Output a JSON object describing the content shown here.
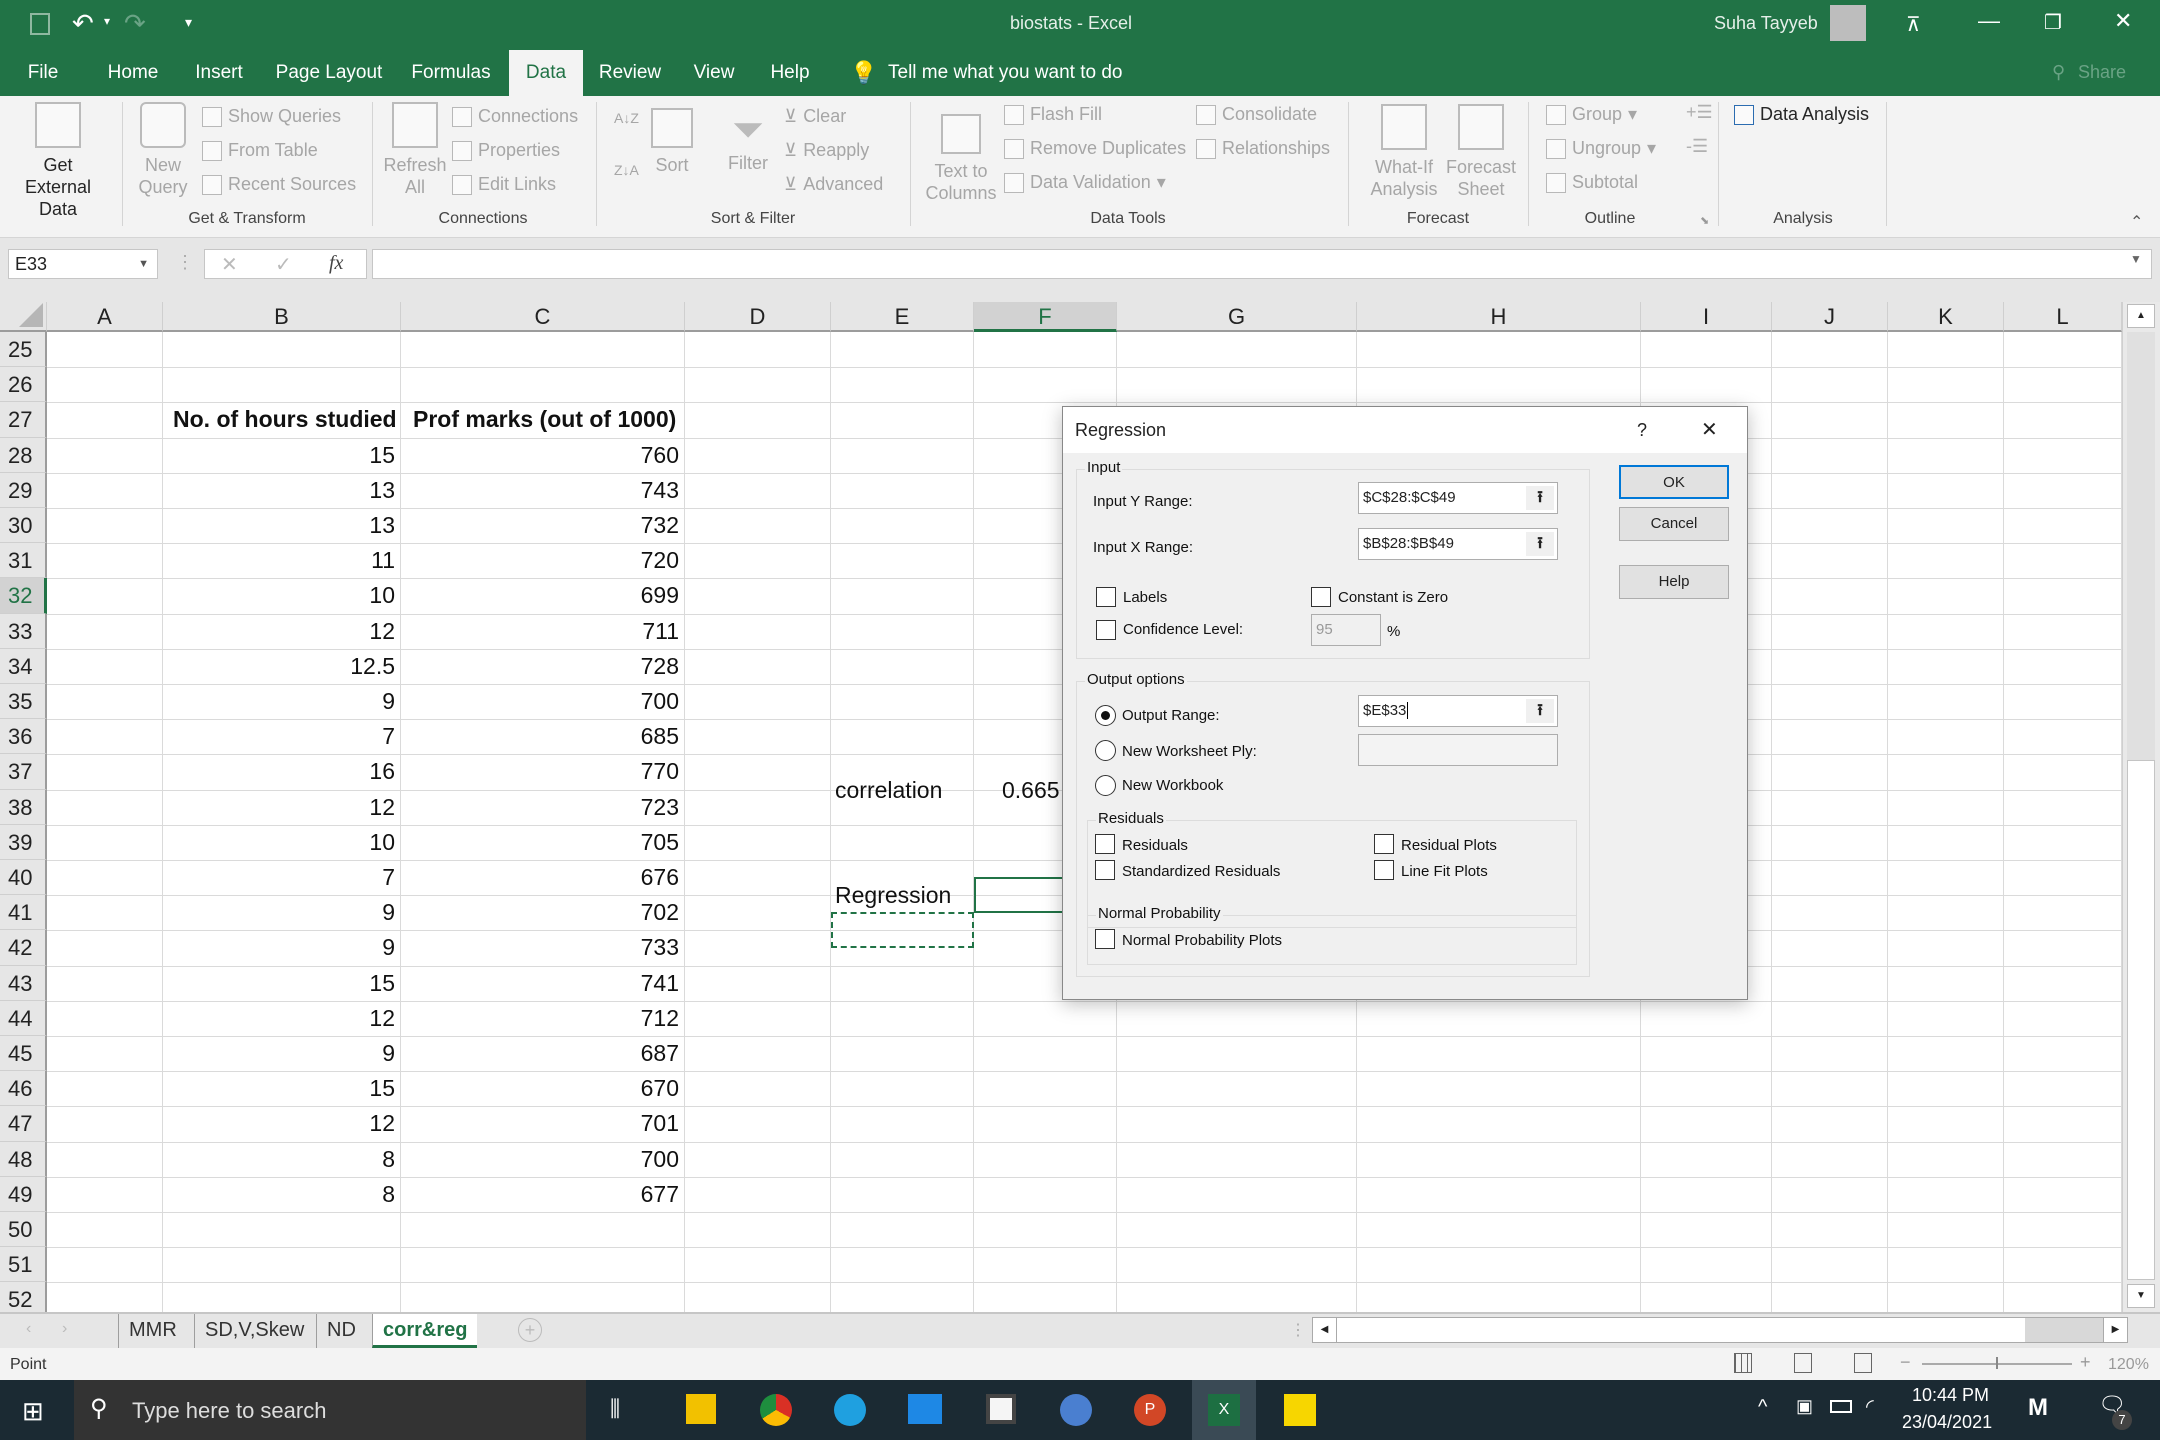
{
  "window": {
    "title": "biostats - Excel",
    "user": "Suha Tayyeb",
    "share_label": "Share"
  },
  "ribbon_tabs": [
    "File",
    "Home",
    "Insert",
    "Page Layout",
    "Formulas",
    "Data",
    "Review",
    "View",
    "Help"
  ],
  "active_tab": "Data",
  "tell_me": "Tell me what you want to do",
  "ribbon": {
    "get_external_data": "Get External Data",
    "get_transform": {
      "label": "Get & Transform",
      "new_query": "New Query",
      "show_queries": "Show Queries",
      "from_table": "From Table",
      "recent_sources": "Recent Sources"
    },
    "connections": {
      "label": "Connections",
      "refresh_all": "Refresh All",
      "connections": "Connections",
      "properties": "Properties",
      "edit_links": "Edit Links"
    },
    "sort_filter": {
      "label": "Sort & Filter",
      "sort": "Sort",
      "filter": "Filter",
      "clear": "Clear",
      "reapply": "Reapply",
      "advanced": "Advanced",
      "sort_az": "A↓Z",
      "sort_za": "Z↓A"
    },
    "data_tools": {
      "label": "Data Tools",
      "text_to_columns": "Text to Columns",
      "flash_fill": "Flash Fill",
      "remove_duplicates": "Remove Duplicates",
      "data_validation": "Data Validation",
      "consolidate": "Consolidate",
      "relationships": "Relationships"
    },
    "forecast": {
      "label": "Forecast",
      "what_if": "What-If Analysis",
      "forecast_sheet": "Forecast Sheet"
    },
    "outline": {
      "label": "Outline",
      "group": "Group",
      "ungroup": "Ungroup",
      "subtotal": "Subtotal"
    },
    "analysis": {
      "label": "Analysis",
      "data_analysis": "Data Analysis"
    }
  },
  "formula_bar": {
    "name_box": "E33",
    "formula": "",
    "fx": "fx"
  },
  "columns": [
    "A",
    "B",
    "C",
    "D",
    "E",
    "F",
    "G",
    "H",
    "I",
    "J",
    "K",
    "L"
  ],
  "selected_column": "F",
  "rows": [
    "25",
    "26",
    "27",
    "28",
    "29",
    "30",
    "31",
    "32",
    "33",
    "34",
    "35",
    "36",
    "37",
    "38",
    "39",
    "40",
    "41",
    "42",
    "43",
    "44",
    "45",
    "46",
    "47",
    "48",
    "49",
    "50",
    "51",
    "52"
  ],
  "selected_row": "32",
  "table": {
    "header_b": "No. of hours studied",
    "header_c": "Prof marks (out of 1000)",
    "hours": [
      "15",
      "13",
      "13",
      "11",
      "10",
      "12",
      "12.5",
      "9",
      "7",
      "16",
      "12",
      "10",
      "7",
      "9",
      "9",
      "15",
      "12",
      "9",
      "15",
      "12",
      "8",
      "8"
    ],
    "marks": [
      "760",
      "743",
      "732",
      "720",
      "699",
      "711",
      "728",
      "700",
      "685",
      "770",
      "723",
      "705",
      "676",
      "702",
      "733",
      "741",
      "712",
      "687",
      "670",
      "701",
      "700",
      "677"
    ]
  },
  "cells": {
    "correlation_label": "correlation",
    "correlation_value": "0.665",
    "regression_label": "Regression"
  },
  "sheet_tabs": [
    "MMR",
    "SD,V,Skew",
    "ND",
    "corr&reg"
  ],
  "active_sheet": "corr&reg",
  "status": {
    "mode": "Point",
    "zoom": "120%"
  },
  "dialog": {
    "title": "Regression",
    "help_glyph": "?",
    "input_group": "Input",
    "input_y_label": "Input Y Range:",
    "input_y_value": "$C$28:$C$49",
    "input_x_label": "Input X Range:",
    "input_x_value": "$B$28:$B$49",
    "labels": "Labels",
    "constant_zero": "Constant is Zero",
    "confidence": "Confidence Level:",
    "confidence_value": "95",
    "percent": "%",
    "output_group": "Output options",
    "output_range": "Output Range:",
    "output_range_value": "$E$33",
    "new_ply": "New Worksheet Ply:",
    "new_ply_value": "",
    "new_workbook": "New Workbook",
    "residuals_group": "Residuals",
    "residuals": "Residuals",
    "std_residuals": "Standardized Residuals",
    "residual_plots": "Residual Plots",
    "line_fit": "Line Fit Plots",
    "normal_group": "Normal Probability",
    "normal_plots": "Normal Probability Plots",
    "ok": "OK",
    "cancel": "Cancel",
    "help": "Help"
  },
  "taskbar": {
    "search_placeholder": "Type here to search",
    "time": "10:44 PM",
    "date": "23/04/2021",
    "notifications": "7"
  }
}
